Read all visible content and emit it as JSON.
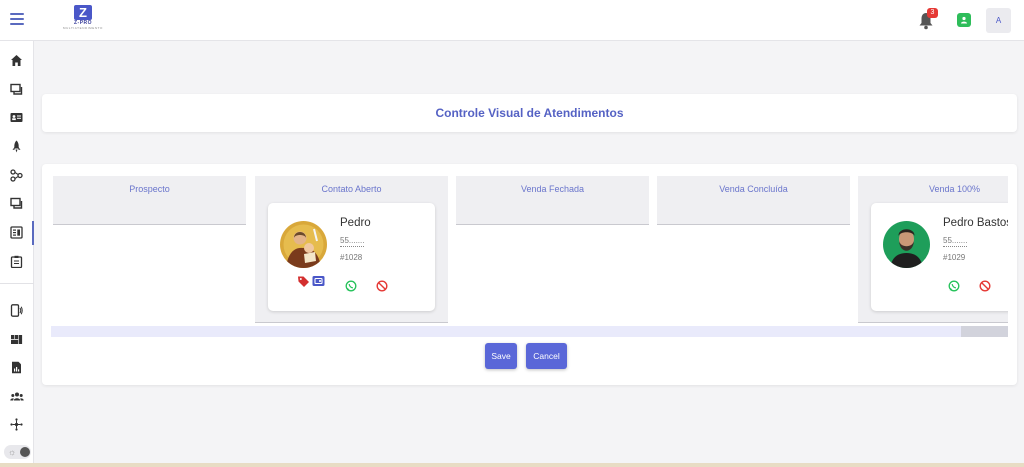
{
  "app": {
    "logo_mark": "Z",
    "logo_title": "Z-PRO",
    "logo_subtitle": "MULTIATENDIMENTO",
    "accent_color": "#5a67d8",
    "title_color": "#5562c4"
  },
  "header": {
    "notification_count": "3",
    "user_initial": "A",
    "icons": [
      "menu-icon",
      "bell-icon",
      "contact-add-icon"
    ]
  },
  "sidebar": {
    "items": [
      {
        "icon": "home-icon"
      },
      {
        "icon": "chat-icon"
      },
      {
        "icon": "contact-card-icon"
      },
      {
        "icon": "rocket-icon"
      },
      {
        "icon": "flow-icon"
      },
      {
        "icon": "messages-icon"
      },
      {
        "icon": "kanban-icon",
        "active": true
      },
      {
        "icon": "clipboard-icon"
      },
      {
        "icon": "phone-signal-icon"
      },
      {
        "icon": "dashboard-icon"
      },
      {
        "icon": "report-icon"
      },
      {
        "icon": "users-group-icon"
      },
      {
        "icon": "network-icon"
      }
    ],
    "toggle_icon": "sun-icon"
  },
  "page": {
    "title": "Controle Visual de Atendimentos"
  },
  "board": {
    "columns": [
      {
        "title": "Prospecto",
        "tickets": []
      },
      {
        "title": "Contato Aberto",
        "tickets": [
          {
            "name": "Pedro",
            "phone": "55.......",
            "id": "#1028",
            "tags": [
              "tag-icon",
              "wallet-icon"
            ],
            "actions": [
              "whatsapp-icon",
              "block-icon"
            ]
          }
        ]
      },
      {
        "title": "Venda Fechada",
        "tickets": []
      },
      {
        "title": "Venda Concluída",
        "tickets": []
      },
      {
        "title": "Venda 100%",
        "tickets": [
          {
            "name": "Pedro Bastos",
            "phone": "55.......",
            "id": "#1029",
            "actions": [
              "whatsapp-icon",
              "block-icon"
            ]
          }
        ]
      }
    ],
    "save_label": "Save",
    "cancel_label": "Cancel",
    "whatsapp_color": "#25c25a",
    "block_color": "#e53935"
  }
}
